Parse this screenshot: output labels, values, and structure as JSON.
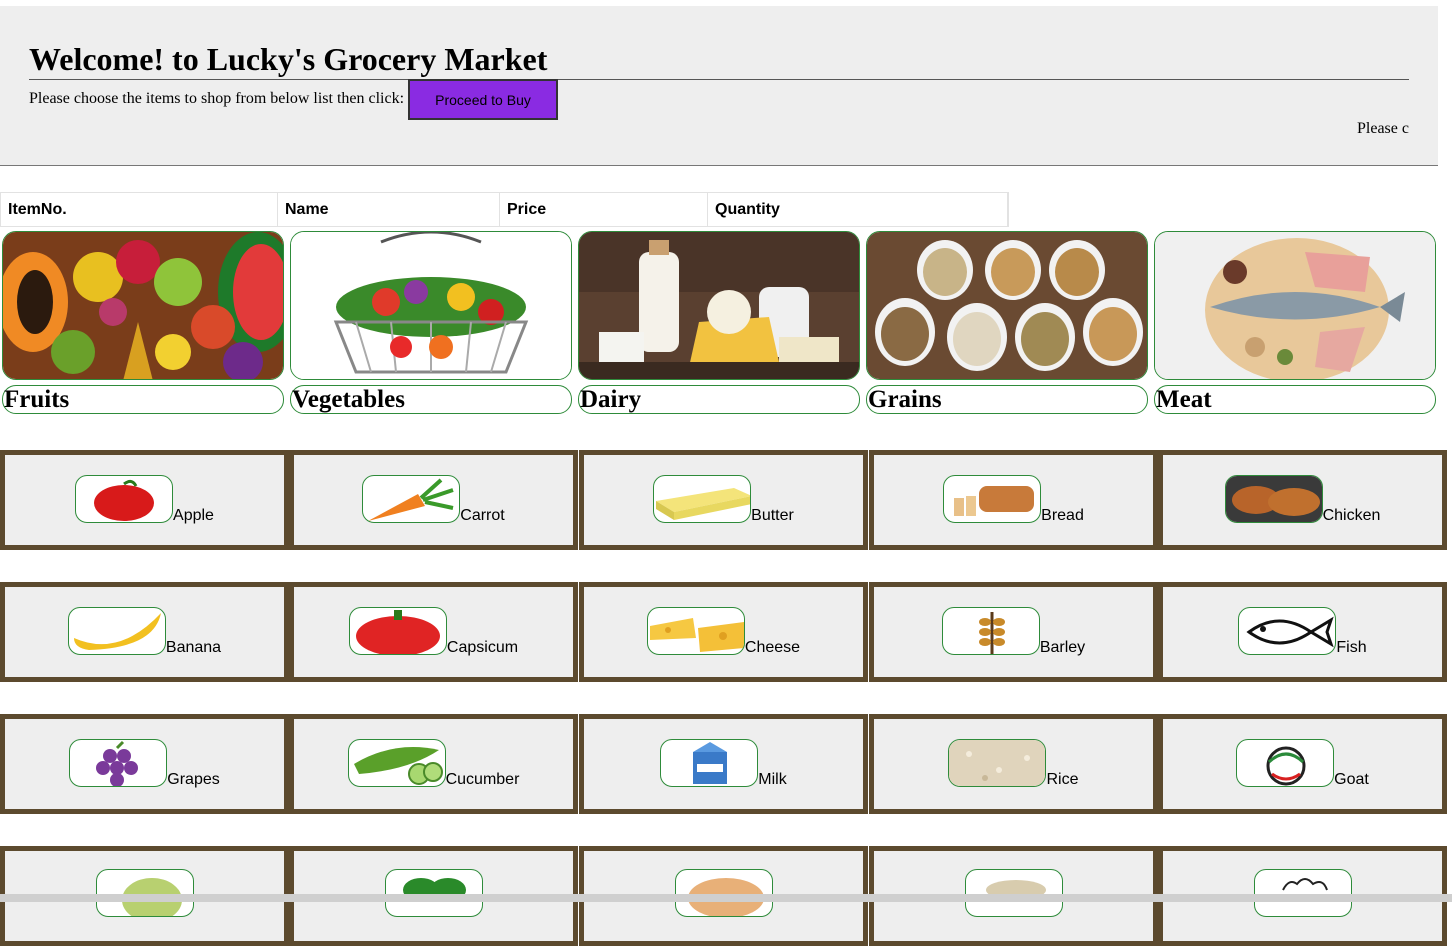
{
  "header": {
    "title": "Welcome! to Lucky's Grocery Market",
    "instruction": "Please choose the items to shop from below list then click:",
    "buy_button": "Proceed to Buy",
    "marquee_text": "Please c"
  },
  "cart": {
    "columns": [
      "ItemNo.",
      "Name",
      "Price",
      "Quantity"
    ]
  },
  "categories": [
    {
      "label": "Fruits",
      "icon": "fruits-photo"
    },
    {
      "label": "Vegetables",
      "icon": "vegetable-basket-photo"
    },
    {
      "label": "Dairy",
      "icon": "dairy-photo"
    },
    {
      "label": "Grains",
      "icon": "grains-photo"
    },
    {
      "label": "Meat",
      "icon": "meat-photo"
    }
  ],
  "rows": [
    [
      {
        "name": "Apple",
        "icon": "apple-icon"
      },
      {
        "name": "Carrot",
        "icon": "carrot-icon"
      },
      {
        "name": "Butter",
        "icon": "butter-icon"
      },
      {
        "name": "Bread",
        "icon": "bread-icon"
      },
      {
        "name": "Chicken",
        "icon": "chicken-icon"
      }
    ],
    [
      {
        "name": "Banana",
        "icon": "banana-icon"
      },
      {
        "name": "Capsicum",
        "icon": "capsicum-icon"
      },
      {
        "name": "Cheese",
        "icon": "cheese-icon"
      },
      {
        "name": "Barley",
        "icon": "barley-icon"
      },
      {
        "name": "Fish",
        "icon": "fish-icon"
      }
    ],
    [
      {
        "name": "Grapes",
        "icon": "grapes-icon"
      },
      {
        "name": "Cucumber",
        "icon": "cucumber-icon"
      },
      {
        "name": "Milk",
        "icon": "milk-icon"
      },
      {
        "name": "Rice",
        "icon": "rice-icon"
      },
      {
        "name": "Goat",
        "icon": "goat-icon"
      }
    ]
  ],
  "colors": {
    "button": "#8a2be2",
    "tile_border": "#5c4a2e",
    "thumb_border": "#2e8b3a",
    "header_bg": "#eeeeee"
  }
}
